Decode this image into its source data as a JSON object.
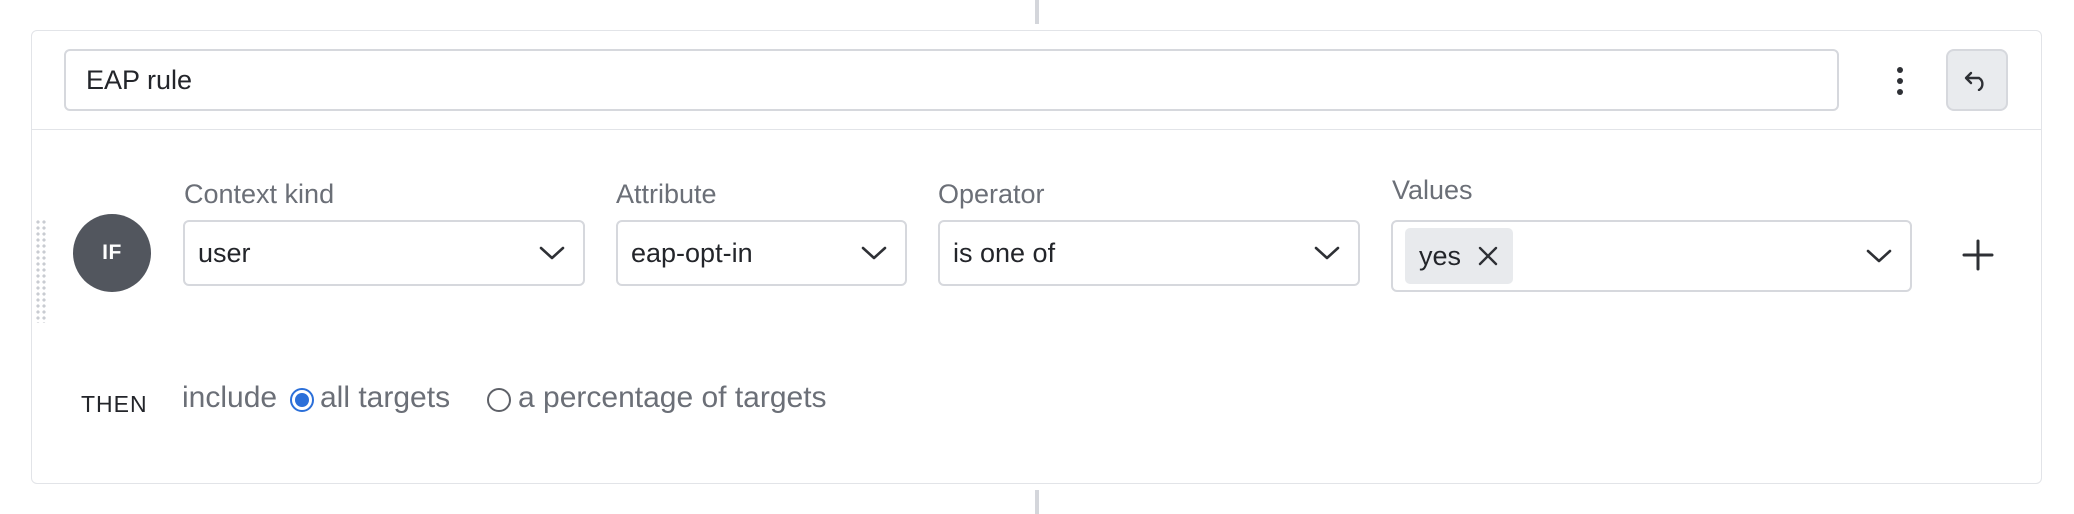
{
  "rule": {
    "name": "EAP rule",
    "condition_badge": "IF",
    "context_kind": {
      "label": "Context kind",
      "value": "user"
    },
    "attribute": {
      "label": "Attribute",
      "value": "eap-opt-in"
    },
    "operator": {
      "label": "Operator",
      "value": "is one of"
    },
    "values": {
      "label": "Values",
      "chips": [
        "yes"
      ]
    },
    "then": {
      "label": "THEN",
      "include_text": "include",
      "options": [
        {
          "label": "all targets",
          "selected": true
        },
        {
          "label": "a percentage of targets",
          "selected": false
        }
      ]
    }
  },
  "icons": {
    "menu": "kebab-icon",
    "undo": "undo-icon",
    "dropdown": "chevron-down-icon",
    "remove_chip": "close-icon",
    "add": "plus-icon"
  },
  "colors": {
    "accent": "#2b6fd9",
    "badge": "#52565e",
    "border": "#d6d8dd"
  }
}
